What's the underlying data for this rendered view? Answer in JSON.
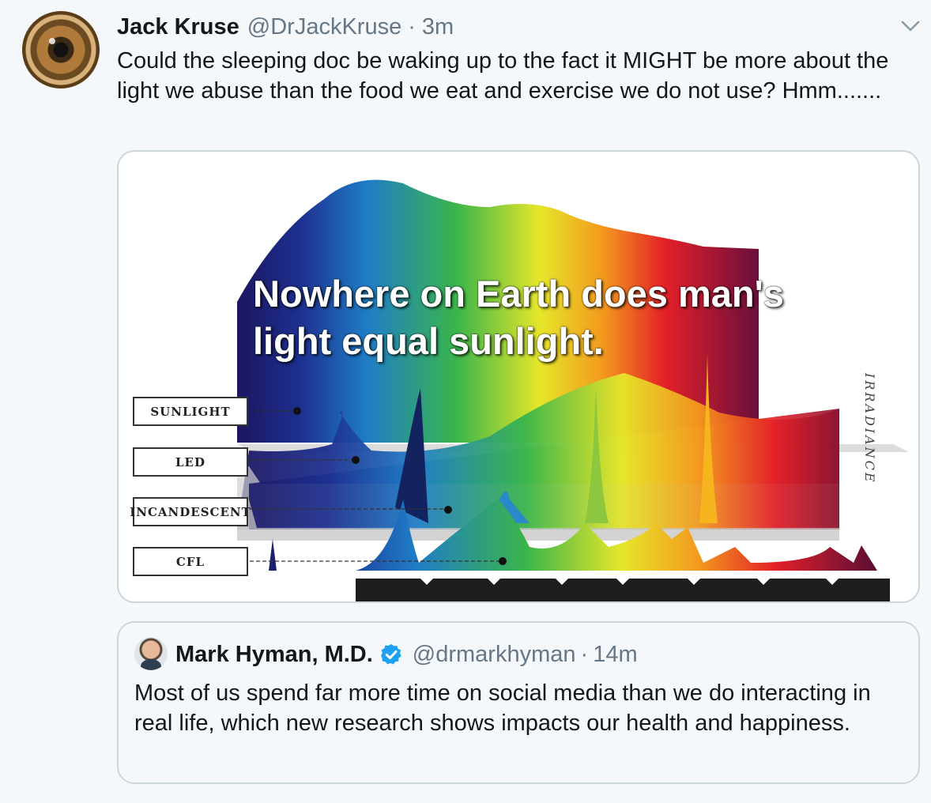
{
  "tweet": {
    "author_name": "Jack Kruse",
    "handle": "@DrJackKruse",
    "separator": "·",
    "time": "3m",
    "text": "Could the sleeping doc be waking up to the fact it MIGHT be more about the light we abuse than the food we eat and exercise we do not use? Hmm.......",
    "more_icon": "chevron-down-icon",
    "avatar_icon": "eye-avatar"
  },
  "media": {
    "overlay_text": "Nowhere on Earth does man's light equal sunlight.",
    "labels": [
      "SUNLIGHT",
      "LED",
      "INCANDESCENT",
      "CFL"
    ],
    "axis_label": "IRRADIANCE"
  },
  "quoted_tweet": {
    "author_name": "Mark Hyman, M.D.",
    "verified_icon": "verified-badge-icon",
    "handle": "@drmarkhyman",
    "separator": "·",
    "time": "14m",
    "text": "Most of us spend far more time on social media than we do interacting in real life, which new research shows impacts our health and happiness."
  },
  "colors": {
    "secondary_text": "#657786",
    "border": "#ccd6dd",
    "verified_blue": "#1da1f2"
  }
}
